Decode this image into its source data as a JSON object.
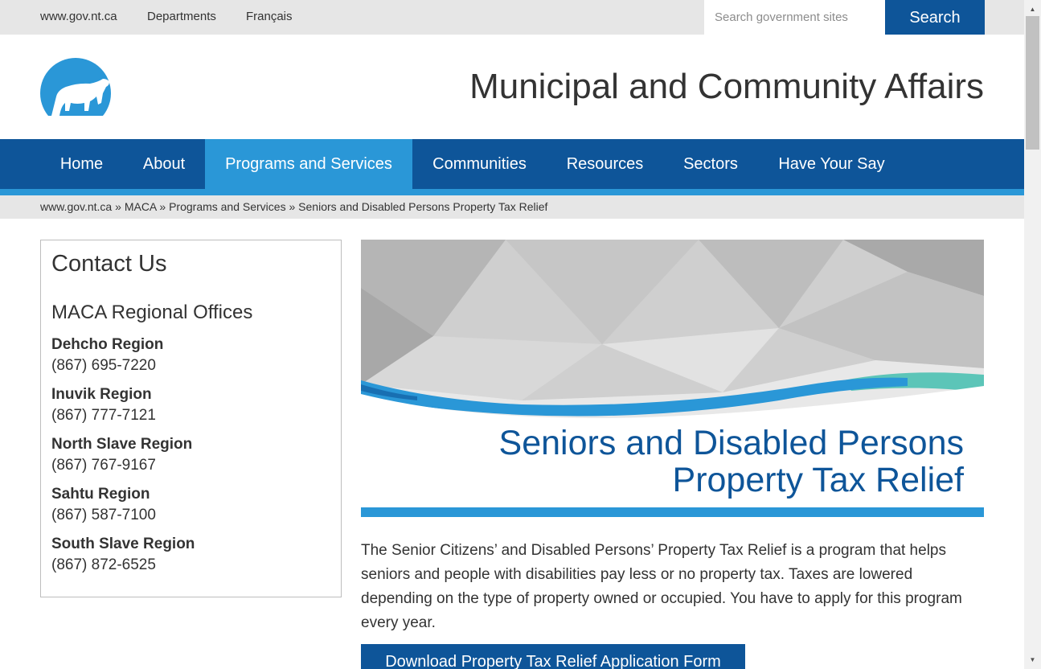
{
  "utility": {
    "links": [
      "www.gov.nt.ca",
      "Departments",
      "Français"
    ],
    "search_placeholder": "Search government sites",
    "search_label": "Search"
  },
  "header": {
    "title": "Municipal and Community Affairs"
  },
  "nav": {
    "items": [
      {
        "label": "Home"
      },
      {
        "label": "About"
      },
      {
        "label": "Programs and Services"
      },
      {
        "label": "Communities"
      },
      {
        "label": "Resources"
      },
      {
        "label": "Sectors"
      },
      {
        "label": "Have Your Say"
      }
    ],
    "active": "Programs and Services"
  },
  "breadcrumb": {
    "items": [
      "www.gov.nt.ca",
      "MACA",
      "Programs and Services",
      "Seniors and Disabled Persons Property Tax Relief"
    ],
    "separator": "»"
  },
  "sidebar": {
    "title": "Contact Us",
    "subtitle": "MACA Regional Offices",
    "regions": [
      {
        "name": "Dehcho Region",
        "phone": "(867) 695-7220"
      },
      {
        "name": "Inuvik Region",
        "phone": "(867) 777-7121"
      },
      {
        "name": "North Slave Region",
        "phone": "(867) 767-9167"
      },
      {
        "name": "Sahtu Region",
        "phone": "(867) 587-7100"
      },
      {
        "name": "South Slave Region",
        "phone": "(867) 872-6525"
      }
    ]
  },
  "main": {
    "heading_line1": "Seniors and Disabled Persons",
    "heading_line2": "Property Tax Relief",
    "intro": "The Senior Citizens’ and Disabled Persons’ Property Tax Relief is a program that helps seniors and people with disabilities pay less or no property tax. Taxes are lowered depending on the type of property owned or occupied. You have to apply for this program every year.",
    "download_label": "Download Property Tax Relief Application Form"
  },
  "colors": {
    "brand_blue": "#0e5599",
    "accent_blue": "#2a97d7",
    "teal": "#5cc5b8"
  },
  "icons": {
    "logo": "polar-bear-logo-icon",
    "scroll_up": "chevron-up-icon",
    "scroll_down": "chevron-down-icon"
  }
}
